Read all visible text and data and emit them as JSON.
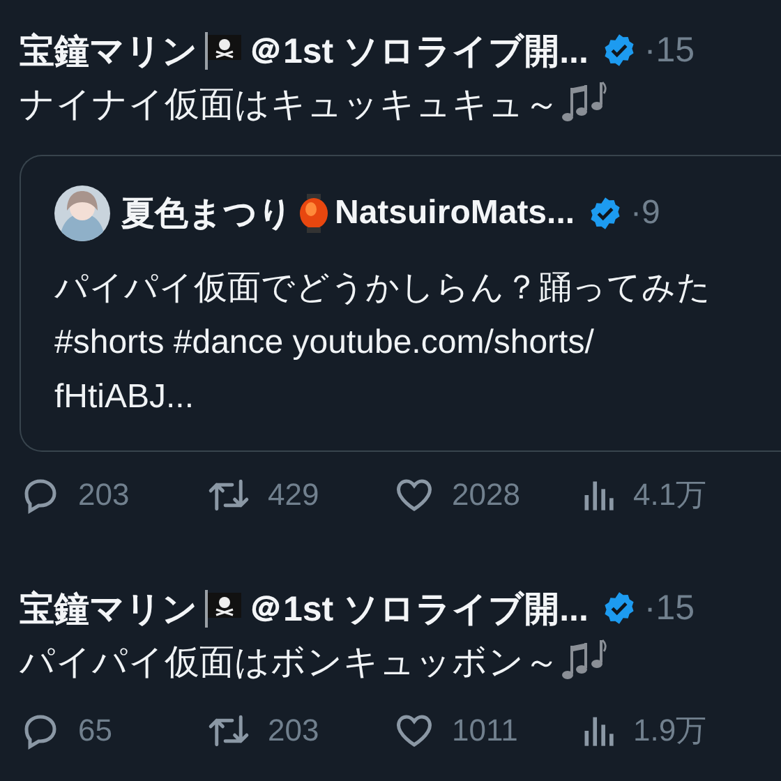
{
  "tweets": [
    {
      "author": {
        "name": "宝鐘マリン",
        "handle_text": "＠1st ソロライブ開...",
        "verified": true,
        "time": "·15"
      },
      "text": "ナイナイ仮面はキュッキュキュ～",
      "quote": {
        "author": {
          "name": "夏色まつり",
          "handle_text": "NatsuiroMats...",
          "verified": true,
          "time": "·9"
        },
        "lines": [
          "パイパイ仮面でどうかしらん？踊ってみた",
          "#shorts #dance youtube.com/shorts/",
          "fHtiABJ..."
        ]
      },
      "actions": [
        {
          "kind": "reply",
          "count": "203"
        },
        {
          "kind": "retweet",
          "count": "429"
        },
        {
          "kind": "like",
          "count": "2028"
        },
        {
          "kind": "views",
          "count": "4.1万"
        }
      ]
    },
    {
      "author": {
        "name": "宝鐘マリン",
        "handle_text": "＠1st ソロライブ開...",
        "verified": true,
        "time": "·15"
      },
      "text": "パイパイ仮面はボンキュッボン～",
      "actions": [
        {
          "kind": "reply",
          "count": "65"
        },
        {
          "kind": "retweet",
          "count": "203"
        },
        {
          "kind": "like",
          "count": "1011"
        },
        {
          "kind": "views",
          "count": "1.9万"
        }
      ]
    }
  ]
}
